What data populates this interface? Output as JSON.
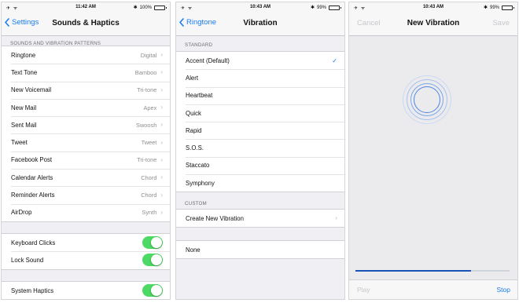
{
  "colors": {
    "accent": "#1a7cf2",
    "toggle_on": "#4cd964",
    "progress": "#1a53b8"
  },
  "screen1": {
    "status": {
      "signal": "✈ ᯤ",
      "time": "11:42 AM",
      "battery": "100%",
      "battery_level": 1.0
    },
    "nav": {
      "back_label": "Settings",
      "title": "Sounds & Haptics"
    },
    "section_header": "SOUNDS AND VIBRATION PATTERNS",
    "patterns": [
      {
        "label": "Ringtone",
        "value": "Digital"
      },
      {
        "label": "Text Tone",
        "value": "Bamboo"
      },
      {
        "label": "New Voicemail",
        "value": "Tri-tone"
      },
      {
        "label": "New Mail",
        "value": "Apex"
      },
      {
        "label": "Sent Mail",
        "value": "Swoosh"
      },
      {
        "label": "Tweet",
        "value": "Tweet"
      },
      {
        "label": "Facebook Post",
        "value": "Tri-tone"
      },
      {
        "label": "Calendar Alerts",
        "value": "Chord"
      },
      {
        "label": "Reminder Alerts",
        "value": "Chord"
      },
      {
        "label": "AirDrop",
        "value": "Synth"
      }
    ],
    "toggles": [
      {
        "label": "Keyboard Clicks",
        "on": true
      },
      {
        "label": "Lock Sound",
        "on": true
      }
    ],
    "haptics": {
      "label": "System Haptics",
      "on": true
    }
  },
  "screen2": {
    "status": {
      "signal": "✈ ᯤ",
      "time": "10:43 AM",
      "battery": "99%",
      "battery_level": 0.99
    },
    "nav": {
      "back_label": "Ringtone",
      "title": "Vibration"
    },
    "standard_header": "STANDARD",
    "standard": [
      {
        "label": "Accent (Default)",
        "selected": true
      },
      {
        "label": "Alert"
      },
      {
        "label": "Heartbeat"
      },
      {
        "label": "Quick"
      },
      {
        "label": "Rapid"
      },
      {
        "label": "S.O.S."
      },
      {
        "label": "Staccato"
      },
      {
        "label": "Symphony"
      }
    ],
    "custom_header": "CUSTOM",
    "custom": {
      "label": "Create New Vibration"
    },
    "none": {
      "label": "None"
    }
  },
  "screen3": {
    "status": {
      "signal": "✈ ᯤ",
      "time": "10:43 AM",
      "battery": "99%",
      "battery_level": 0.99
    },
    "nav": {
      "left": "Cancel",
      "title": "New Vibration",
      "right": "Save"
    },
    "progress": 0.75,
    "play_label": "Play",
    "stop_label": "Stop"
  }
}
